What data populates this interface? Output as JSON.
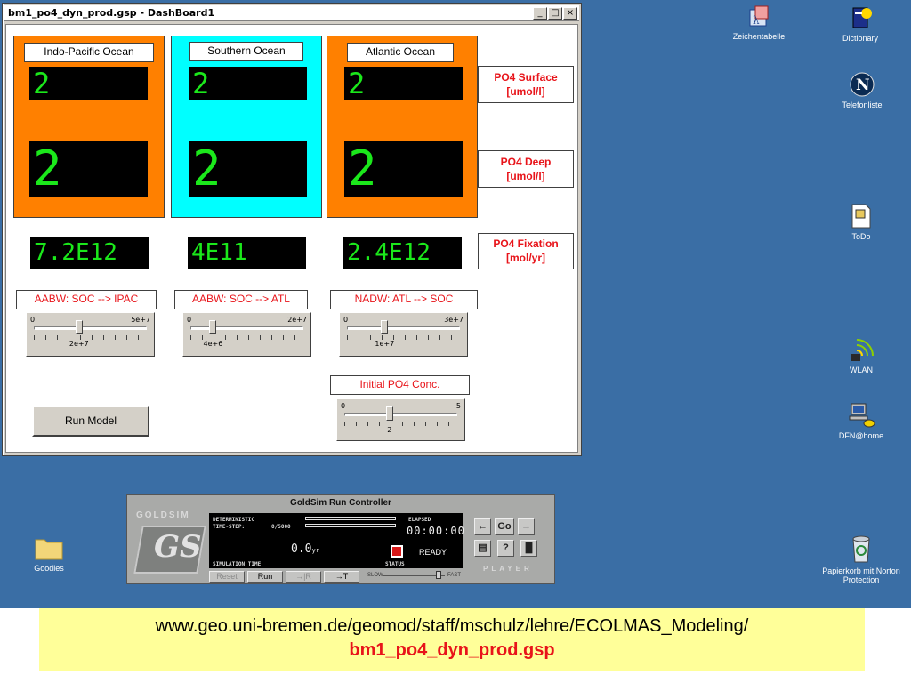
{
  "window": {
    "title": "bm1_po4_dyn_prod.gsp - DashBoard1",
    "minimize": "_",
    "maximize": "□",
    "close": "×"
  },
  "panels": [
    {
      "name": "Indo-Pacific Ocean",
      "color": "#ff8000",
      "surface_lcd": "2",
      "deep_lcd": "2",
      "fixation_lcd": "7.2E12"
    },
    {
      "name": "Southern Ocean",
      "color": "#00ffff",
      "surface_lcd": "2",
      "deep_lcd": "2",
      "fixation_lcd": "4E11"
    },
    {
      "name": "Atlantic Ocean",
      "color": "#ff8000",
      "surface_lcd": "2",
      "deep_lcd": "2",
      "fixation_lcd": "2.4E12"
    }
  ],
  "row_labels": {
    "surface": "PO4 Surface\n[umol/l]",
    "deep": "PO4 Deep\n[umol/l]",
    "fixation": "PO4 Fixation\n[mol/yr]"
  },
  "flows": [
    {
      "label": "AABW: SOC --> IPAC",
      "min": "0",
      "max": "5e+7",
      "value": "2e+7",
      "fraction": 0.4
    },
    {
      "label": "AABW: SOC --> ATL",
      "min": "0",
      "max": "2e+7",
      "value": "4e+6",
      "fraction": 0.2
    },
    {
      "label": "NADW: ATL --> SOC",
      "min": "0",
      "max": "3e+7",
      "value": "1e+7",
      "fraction": 0.333
    }
  ],
  "initial_conc": {
    "label": "Initial PO4 Conc.",
    "min": "0",
    "max": "5",
    "value": "2",
    "fraction": 0.4
  },
  "run_model_button": "Run Model",
  "run_controller": {
    "title": "GoldSim Run Controller",
    "logo_word": "GOLDSIM",
    "logo_letters": "GS",
    "mode": "DETERMINISTIC",
    "timestep_label": "TIME-STEP:",
    "timestep_value": "0/5000",
    "elapsed_label": "ELAPSED",
    "elapsed_value": "00:00:00",
    "sim_time": "0.0",
    "sim_time_unit": "yr",
    "sim_time_label": "SIMULATION TIME",
    "status_label": "STATUS",
    "status_value": "READY",
    "buttons": {
      "reset": "Reset",
      "run": "Run",
      "step": "→|R",
      "pause_at": "→T"
    },
    "speed_slow": "SLOW",
    "speed_fast": "FAST",
    "go": "Go",
    "help": "?",
    "player": "PLAYER",
    "accent_red": "#d81818"
  },
  "desktop_icons": [
    {
      "id": "charmap",
      "label": "Zeichentabelle",
      "icon": "character-map-icon"
    },
    {
      "id": "dictionary",
      "label": "Dictionary",
      "icon": "dictionary-icon"
    },
    {
      "id": "phonelist",
      "label": "Telefonliste",
      "icon": "netscape-icon"
    },
    {
      "id": "todo",
      "label": "ToDo",
      "icon": "todo-document-icon"
    },
    {
      "id": "wlan",
      "label": "WLAN",
      "icon": "wireless-icon"
    },
    {
      "id": "dfn",
      "label": "DFN@home",
      "icon": "network-computer-icon"
    },
    {
      "id": "goodies",
      "label": "Goodies",
      "icon": "folder-icon"
    },
    {
      "id": "recycle",
      "label": "Papierkorb mit Norton Protection",
      "icon": "recycle-bin-icon"
    }
  ],
  "footer": {
    "url": "www.geo.uni-bremen.de/geomod/staff/mschulz/lehre/ECOLMAS_Modeling/",
    "filename": "bm1_po4_dyn_prod.gsp"
  },
  "colors": {
    "desktop": "#3a6ea5",
    "lcd_green": "#1be81b",
    "label_red": "#e8141a",
    "footer_bg": "#ffff99"
  }
}
